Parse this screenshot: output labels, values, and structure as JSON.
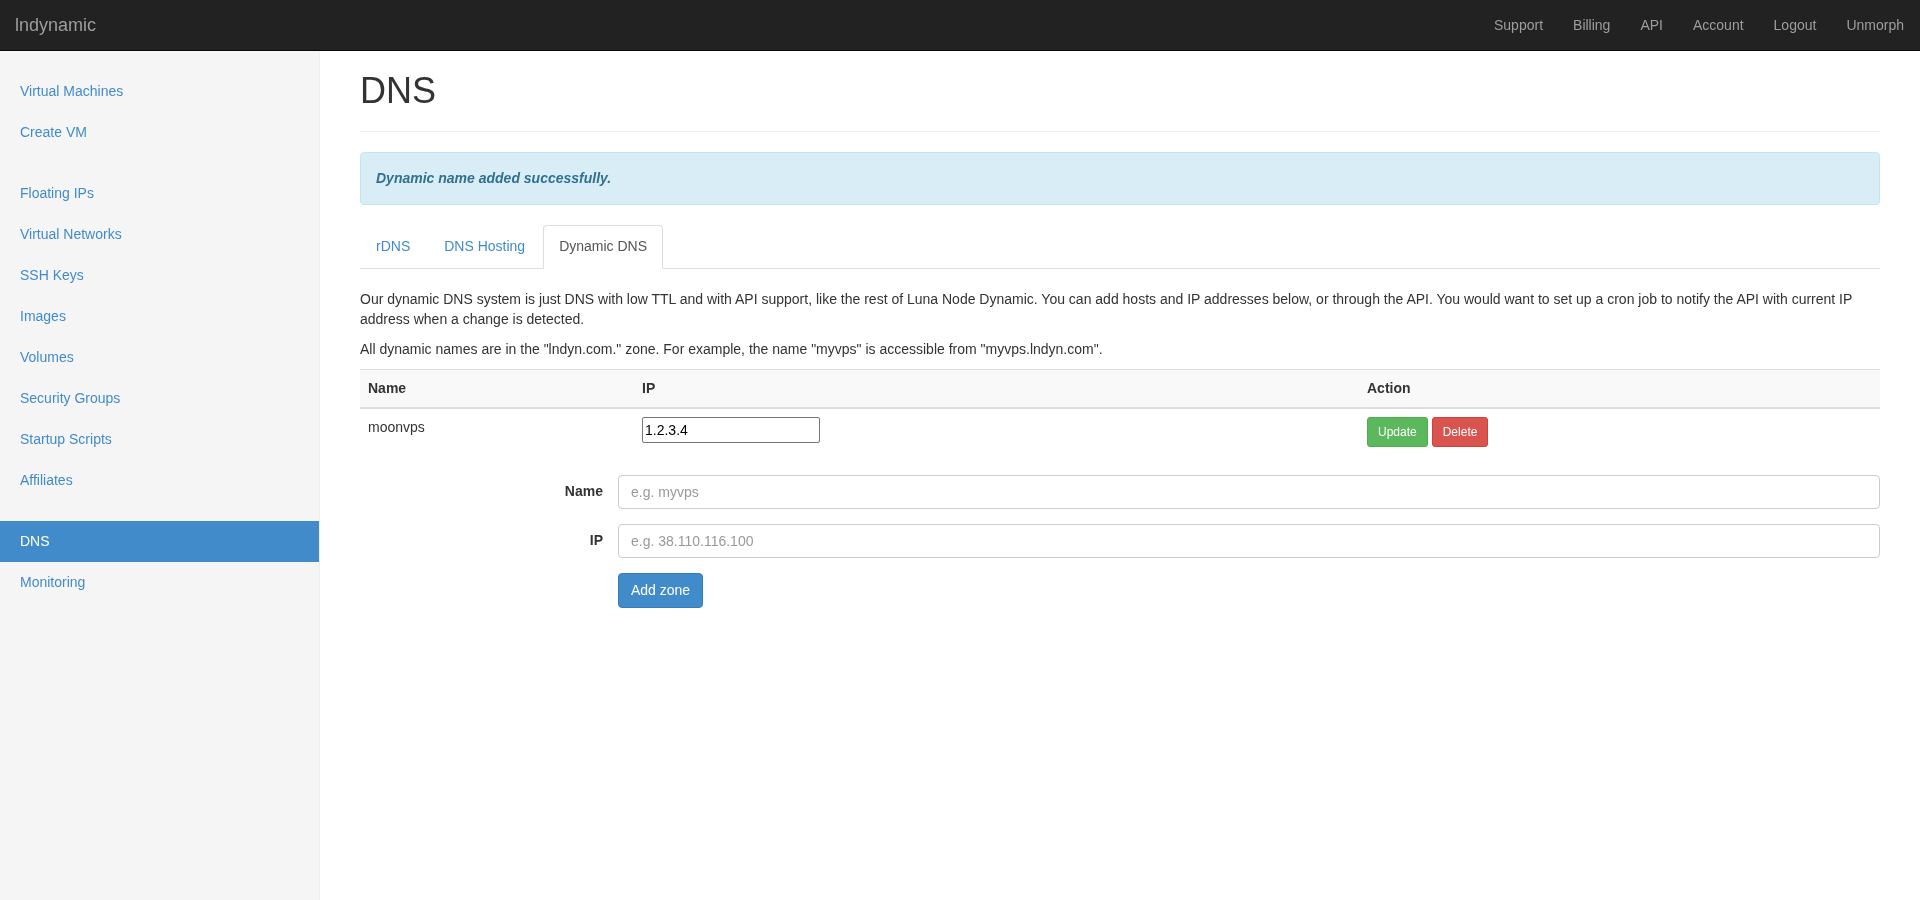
{
  "navbar": {
    "brand": "lndynamic",
    "links": [
      "Support",
      "Billing",
      "API",
      "Account",
      "Logout",
      "Unmorph"
    ]
  },
  "sidebar": {
    "groups": [
      {
        "items": [
          {
            "label": "Virtual Machines",
            "selected": false
          },
          {
            "label": "Create VM",
            "selected": false
          }
        ]
      },
      {
        "items": [
          {
            "label": "Floating IPs",
            "selected": false
          },
          {
            "label": "Virtual Networks",
            "selected": false
          },
          {
            "label": "SSH Keys",
            "selected": false
          },
          {
            "label": "Images",
            "selected": false
          },
          {
            "label": "Volumes",
            "selected": false
          },
          {
            "label": "Security Groups",
            "selected": false
          },
          {
            "label": "Startup Scripts",
            "selected": false
          },
          {
            "label": "Affiliates",
            "selected": false
          }
        ]
      },
      {
        "items": [
          {
            "label": "DNS",
            "selected": true
          },
          {
            "label": "Monitoring",
            "selected": false
          }
        ]
      }
    ]
  },
  "page": {
    "title": "DNS",
    "alert": "Dynamic name added successfully.",
    "tabs": [
      {
        "label": "rDNS",
        "selected": false
      },
      {
        "label": "DNS Hosting",
        "selected": false
      },
      {
        "label": "Dynamic DNS",
        "selected": true
      }
    ],
    "paragraphs": [
      "Our dynamic DNS system is just DNS with low TTL and with API support, like the rest of Luna Node Dynamic. You can add hosts and IP addresses below, or through the API. You would want to set up a cron job to notify the API with current IP address when a change is detected.",
      "All dynamic names are in the \"lndyn.com.\" zone. For example, the name \"myvps\" is accessible from \"myvps.lndyn.com\"."
    ],
    "table": {
      "columns": [
        "Name",
        "IP",
        "Action"
      ],
      "rows": [
        {
          "name": "moonvps",
          "ip": "1.2.3.4",
          "actions": [
            {
              "kind": "update",
              "label": "Update"
            },
            {
              "kind": "delete",
              "label": "Delete"
            }
          ]
        }
      ]
    },
    "form": {
      "fields": [
        {
          "label": "Name",
          "placeholder": "e.g. myvps"
        },
        {
          "label": "IP",
          "placeholder": "e.g. 38.110.116.100"
        }
      ],
      "submit": "Add zone"
    }
  }
}
